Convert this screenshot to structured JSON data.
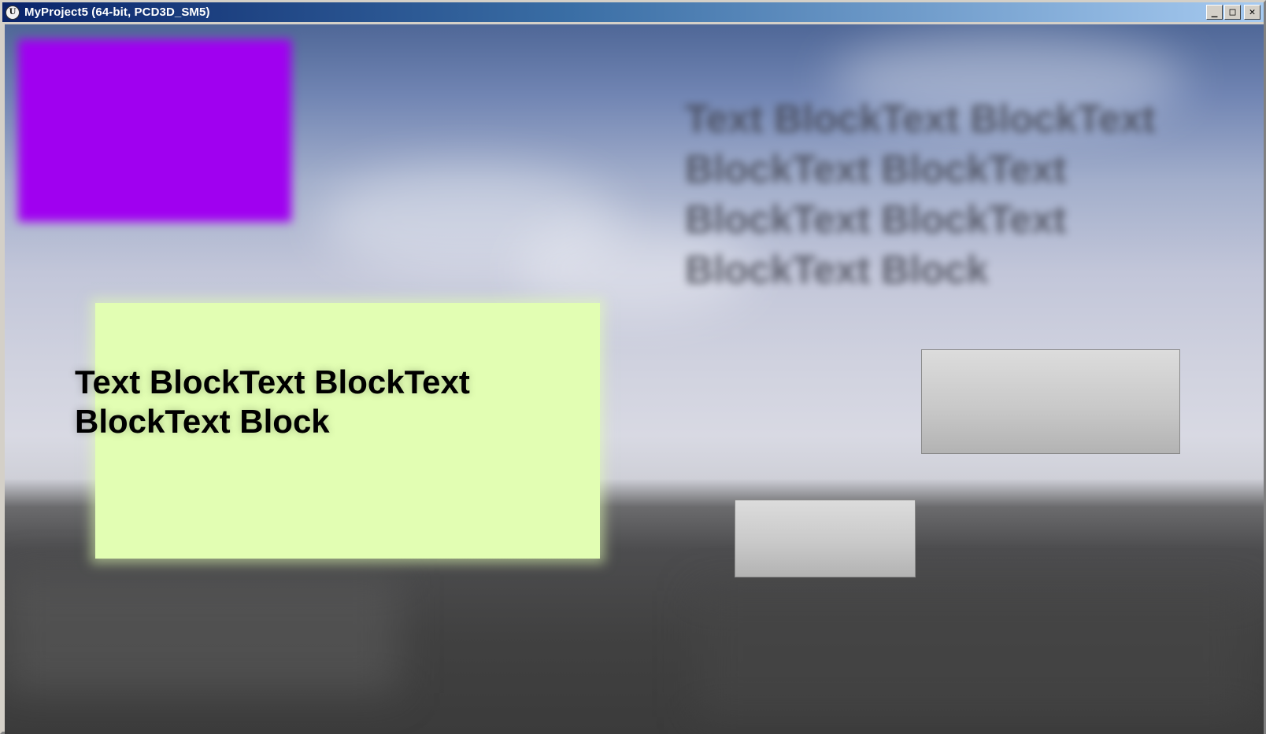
{
  "window": {
    "title": "MyProject5 (64-bit, PCD3D_SM5)",
    "icon": "unreal-logo-icon",
    "controls": {
      "minimize": "_",
      "maximize": "□",
      "close": "✕"
    }
  },
  "viewport": {
    "blurred_text": "Text BlockText BlockText BlockText BlockText BlockText BlockText BlockText Block",
    "panel_text": "Text BlockText BlockText BlockText Block",
    "colors": {
      "purple_box": "#a000f0",
      "lime_panel": "#e2feb3",
      "button_face": "#c9c9c9"
    }
  }
}
